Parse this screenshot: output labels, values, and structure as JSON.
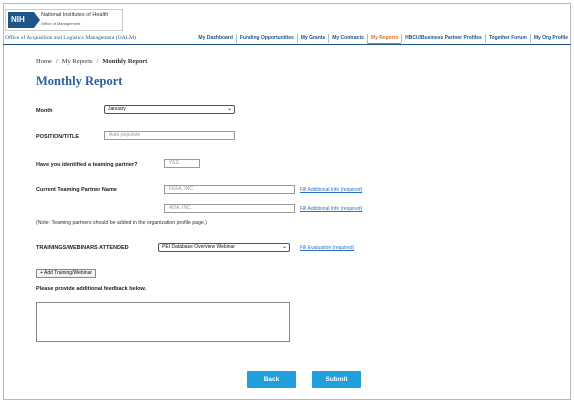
{
  "header": {
    "logo_badge": "NIH",
    "org_name": "National Institutes of Health",
    "org_sub": "Office of Management",
    "office_name": "Office of Acquisition and Logistics Management (OALM)"
  },
  "nav": {
    "items": [
      {
        "label": "My Dashboard"
      },
      {
        "label": "Funding Opportunities"
      },
      {
        "label": "My Grants"
      },
      {
        "label": "My Contracts"
      },
      {
        "label": "My Reports"
      },
      {
        "label": "HBCU/Business Partner Profiles"
      },
      {
        "label": "Together Forum"
      },
      {
        "label": "My Org Profile"
      }
    ],
    "active": "My Reports"
  },
  "breadcrumb": {
    "home": "Home",
    "sep": "/",
    "reports": "My Reports",
    "current": "Monthly Report"
  },
  "page_title": "Monthly Report",
  "form": {
    "month_label": "Month",
    "month_value": "January",
    "position_label": "POSITION/TITLE",
    "position_placeholder": "Auto-populate",
    "teaming_question": "Have you identified a teaming partner?",
    "teaming_value": "YES",
    "partner_label": "Current Teaming Partner Name",
    "partners": [
      {
        "name": "FEFA, INC.",
        "link": "Fill Additional Info (required)"
      },
      {
        "name": "ADA, INC.",
        "link": "Fill Additional Info (required)"
      }
    ],
    "note": "(Note: Teaming partners should be added in the organization profile page.)",
    "training_label": "TRAININGS/WEBINARS ATTENDED",
    "training_value": "PEI Database Overview Webinar",
    "training_link": "Fill Evaluation (required)",
    "add_training_label": "+ Add Training/Webinar",
    "feedback_label": "Please provide additional feedback below.",
    "feedback_value": ""
  },
  "actions": {
    "back": "Back",
    "submit": "Submit"
  },
  "colors": {
    "brand_blue": "#20558a",
    "title_blue": "#2a5e9c",
    "active_nav": "#d9742b",
    "button_blue": "#1fa0dd",
    "link_blue": "#2a72c8"
  }
}
